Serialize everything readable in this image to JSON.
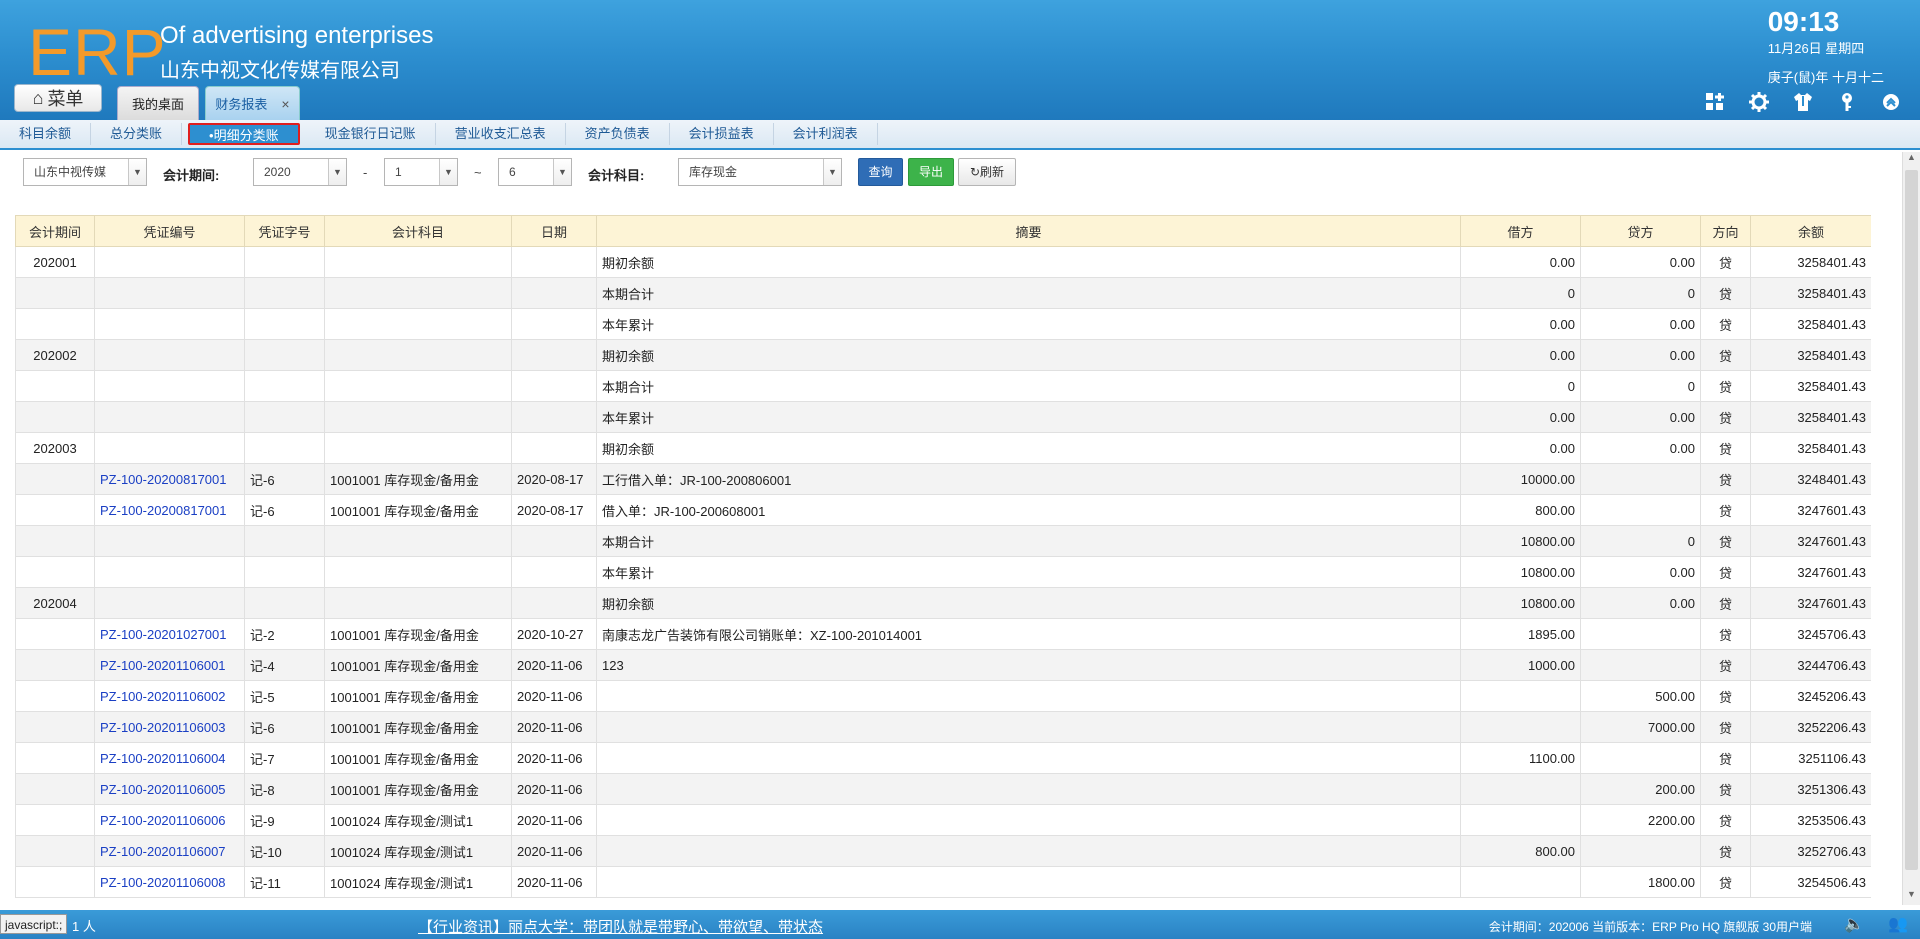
{
  "header": {
    "logo": "ERP",
    "company_en": "Of advertising enterprises",
    "company_cn": "山东中视文化传媒有限公司",
    "time": "09:13",
    "date": "11月26日 星期四",
    "lunar": "庚子(鼠)年 十月十二",
    "menu_label": "菜单",
    "tabs": [
      {
        "label": "我的桌面"
      },
      {
        "label": "财务报表",
        "close": "×"
      }
    ],
    "tool_icons": [
      "add-window-icon",
      "gear-icon",
      "shirt-icon",
      "key-icon",
      "collapse-icon"
    ]
  },
  "subnav": [
    {
      "label": "科目余额"
    },
    {
      "label": "总分类账"
    },
    {
      "label": "•明细分类账",
      "active": true
    },
    {
      "label": "现金银行日记账"
    },
    {
      "label": "营业收支汇总表"
    },
    {
      "label": "资产负债表"
    },
    {
      "label": "会计损益表"
    },
    {
      "label": "会计利润表"
    }
  ],
  "filter": {
    "company": "山东中视传媒",
    "period_label": "会计期间:",
    "year": "2020",
    "dash": "-",
    "month_from": "1",
    "tilde": "~",
    "month_to": "6",
    "subject_label": "会计科目:",
    "subject": "库存现金",
    "query": "查询",
    "export": "导出",
    "refresh": "刷新"
  },
  "table": {
    "headers": [
      "会计期间",
      "凭证编号",
      "凭证字号",
      "会计科目",
      "日期",
      "摘要",
      "借方",
      "贷方",
      "方向",
      "余额"
    ],
    "rows": [
      [
        "202001",
        "",
        "",
        "",
        "",
        "期初余额",
        "0.00",
        "0.00",
        "贷",
        "3258401.43"
      ],
      [
        "",
        "",
        "",
        "",
        "",
        "本期合计",
        "0",
        "0",
        "贷",
        "3258401.43"
      ],
      [
        "",
        "",
        "",
        "",
        "",
        "本年累计",
        "0.00",
        "0.00",
        "贷",
        "3258401.43"
      ],
      [
        "202002",
        "",
        "",
        "",
        "",
        "期初余额",
        "0.00",
        "0.00",
        "贷",
        "3258401.43"
      ],
      [
        "",
        "",
        "",
        "",
        "",
        "本期合计",
        "0",
        "0",
        "贷",
        "3258401.43"
      ],
      [
        "",
        "",
        "",
        "",
        "",
        "本年累计",
        "0.00",
        "0.00",
        "贷",
        "3258401.43"
      ],
      [
        "202003",
        "",
        "",
        "",
        "",
        "期初余额",
        "0.00",
        "0.00",
        "贷",
        "3258401.43"
      ],
      [
        "",
        "PZ-100-20200817001",
        "记-6",
        "1001001 库存现金/备用金",
        "2020-08-17",
        "工行借入单：JR-100-200806001",
        "10000.00",
        "",
        "贷",
        "3248401.43"
      ],
      [
        "",
        "PZ-100-20200817001",
        "记-6",
        "1001001 库存现金/备用金",
        "2020-08-17",
        "借入单：JR-100-200608001",
        "800.00",
        "",
        "贷",
        "3247601.43"
      ],
      [
        "",
        "",
        "",
        "",
        "",
        "本期合计",
        "10800.00",
        "0",
        "贷",
        "3247601.43"
      ],
      [
        "",
        "",
        "",
        "",
        "",
        "本年累计",
        "10800.00",
        "0.00",
        "贷",
        "3247601.43"
      ],
      [
        "202004",
        "",
        "",
        "",
        "",
        "期初余额",
        "10800.00",
        "0.00",
        "贷",
        "3247601.43"
      ],
      [
        "",
        "PZ-100-20201027001",
        "记-2",
        "1001001 库存现金/备用金",
        "2020-10-27",
        "南康志龙广告装饰有限公司销账单：XZ-100-201014001",
        "1895.00",
        "",
        "贷",
        "3245706.43"
      ],
      [
        "",
        "PZ-100-20201106001",
        "记-4",
        "1001001 库存现金/备用金",
        "2020-11-06",
        "123",
        "1000.00",
        "",
        "贷",
        "3244706.43"
      ],
      [
        "",
        "PZ-100-20201106002",
        "记-5",
        "1001001 库存现金/备用金",
        "2020-11-06",
        "",
        "",
        "500.00",
        "贷",
        "3245206.43"
      ],
      [
        "",
        "PZ-100-20201106003",
        "记-6",
        "1001001 库存现金/备用金",
        "2020-11-06",
        "",
        "",
        "7000.00",
        "贷",
        "3252206.43"
      ],
      [
        "",
        "PZ-100-20201106004",
        "记-7",
        "1001001 库存现金/备用金",
        "2020-11-06",
        "",
        "1100.00",
        "",
        "贷",
        "3251106.43"
      ],
      [
        "",
        "PZ-100-20201106005",
        "记-8",
        "1001001 库存现金/备用金",
        "2020-11-06",
        "",
        "",
        "200.00",
        "贷",
        "3251306.43"
      ],
      [
        "",
        "PZ-100-20201106006",
        "记-9",
        "1001024 库存现金/测试1",
        "2020-11-06",
        "",
        "",
        "2200.00",
        "贷",
        "3253506.43"
      ],
      [
        "",
        "PZ-100-20201106007",
        "记-10",
        "1001024 库存现金/测试1",
        "2020-11-06",
        "",
        "800.00",
        "",
        "贷",
        "3252706.43"
      ],
      [
        "",
        "PZ-100-20201106008",
        "记-11",
        "1001024 库存现金/测试1",
        "2020-11-06",
        "",
        "",
        "1800.00",
        "贷",
        "3254506.43"
      ]
    ]
  },
  "footer": {
    "status": "javascript:;",
    "online": "1 人",
    "news": "【行业资讯】丽点大学：带团队就是带野心、带欲望、带状态",
    "info": "会计期间：202006 当前版本：ERP Pro HQ 旗舰版 30用户端"
  }
}
